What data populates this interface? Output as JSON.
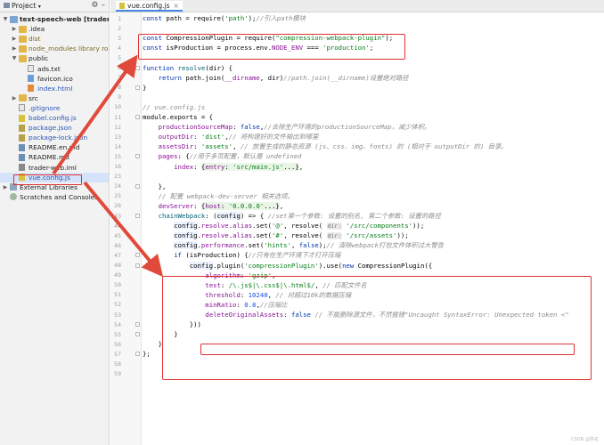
{
  "project_panel": {
    "title": "Project",
    "tree": [
      {
        "label": "text-speech-web [trader-web]",
        "depth": 0,
        "expanded": true,
        "icon": "folder-blue",
        "style": "bold"
      },
      {
        "label": ".idea",
        "depth": 1,
        "expanded": false,
        "icon": "folder"
      },
      {
        "label": "dist",
        "depth": 1,
        "expanded": false,
        "icon": "folder",
        "style": "olive"
      },
      {
        "label": "node_modules  library root",
        "depth": 1,
        "expanded": false,
        "icon": "folder",
        "style": "olive"
      },
      {
        "label": "public",
        "depth": 1,
        "expanded": true,
        "icon": "folder"
      },
      {
        "label": "ads.txt",
        "depth": 2,
        "icon": "file-txt"
      },
      {
        "label": "favicon.ico",
        "depth": 2,
        "icon": "file-ico"
      },
      {
        "label": "index.html",
        "depth": 2,
        "icon": "file-html",
        "style": "blue"
      },
      {
        "label": "src",
        "depth": 1,
        "expanded": false,
        "icon": "folder"
      },
      {
        "label": ".gitignore",
        "depth": 1,
        "icon": "file-txt",
        "style": "blue"
      },
      {
        "label": "babel.config.js",
        "depth": 1,
        "icon": "file-js",
        "style": "blue"
      },
      {
        "label": "package.json",
        "depth": 1,
        "icon": "file-json",
        "style": "blue"
      },
      {
        "label": "package-lock.json",
        "depth": 1,
        "icon": "file-json",
        "style": "blue"
      },
      {
        "label": "README.en.md",
        "depth": 1,
        "icon": "file-md"
      },
      {
        "label": "README.md",
        "depth": 1,
        "icon": "file-md"
      },
      {
        "label": "trader-web.iml",
        "depth": 1,
        "icon": "file-iml"
      },
      {
        "label": "vue.config.js",
        "depth": 1,
        "icon": "file-js",
        "style": "blue",
        "selected": true
      },
      {
        "label": "External Libraries",
        "depth": 0,
        "expanded": false,
        "icon": "lib"
      },
      {
        "label": "Scratches and Consoles",
        "depth": 0,
        "icon": "scratch"
      }
    ]
  },
  "editor": {
    "tab_label": "vue.config.js",
    "lines": [
      {
        "n": 1,
        "html": "<span class=\"kw\">const</span> path = require(<span class=\"str\">'path'</span>);<span class=\"cm\">//引入path模块</span>"
      },
      {
        "n": 2,
        "html": ""
      },
      {
        "n": 3,
        "html": "<span class=\"kw\">const</span> CompressionPlugin = require(<span class=\"str\">\"compression-webpack-plugin\"</span>);"
      },
      {
        "n": 4,
        "html": "<span class=\"kw\">const</span> isProduction = process.env.<span class=\"prop\">NODE_ENV</span> === <span class=\"str\">'production'</span>;"
      },
      {
        "n": 5,
        "html": ""
      },
      {
        "n": 6,
        "html": "<span class=\"kw\">function</span> <span class=\"fn\">resolve</span>(dir) {"
      },
      {
        "n": 7,
        "html": "    <span class=\"kw\">return</span> path.join(<span class=\"prop\">__dirname</span>, dir)<span class=\"cm\">//path.join(__dirname)设置绝对路径</span>"
      },
      {
        "n": 8,
        "html": "}"
      },
      {
        "n": 9,
        "html": ""
      },
      {
        "n": 10,
        "html": "<span class=\"cm\">// vue.config.js</span>"
      },
      {
        "n": 11,
        "html": "module.exports = {"
      },
      {
        "n": 12,
        "html": "    <span class=\"prop\">productionSourceMap</span>: <span class=\"kw\">false</span>,<span class=\"cm\">//去除生产环境的productionSourceMap，减少体积。</span>"
      },
      {
        "n": 13,
        "html": "    <span class=\"prop\">outputDir</span>: <span class=\"str\">'dist'</span>,<span class=\"cm\">// 将构建好的文件输出到哪里</span>"
      },
      {
        "n": 14,
        "html": "    <span class=\"prop\">assetsDir</span>: <span class=\"str\">'assets'</span>, <span class=\"cm\">// 放置生成的静态资源 (js、css、img、fonts) 的 (相对于 outputDir 的) 目录。</span>"
      },
      {
        "n": 15,
        "html": "    <span class=\"prop\">pages</span>: {<span class=\"cm\">//用于多页配置，默认是 undefined</span>"
      },
      {
        "n": 16,
        "html": "        <span class=\"prop\">index</span>: <span class=\"fb\">{<span class=\"prop\">entry</span>: <span class=\"str\">'src/main.js'</span>...}</span>,"
      },
      {
        "n": 23,
        "html": ""
      },
      {
        "n": 24,
        "html": "    },"
      },
      {
        "n": 25,
        "html": "    <span class=\"cm\">// 配置 webpack-dev-server 相关选项。</span>"
      },
      {
        "n": 26,
        "html": "    <span class=\"prop\">devServer</span>: <span class=\"fb\">{<span class=\"prop\">host</span>: <span class=\"str\">'0.0.0.0'</span>...}</span>,"
      },
      {
        "n": 43,
        "html": "    <span class=\"fn\">chainWebpack</span>: (<span class=\"hlv\">config</span>) => { <span class=\"cm\">//set第一个参数: 设置的别名, 第二个参数: 设置的路径</span>"
      },
      {
        "n": 44,
        "html": "        <span class=\"hlv\">config</span>.<span class=\"prop\">resolve</span>.<span class=\"prop\">alias</span>.set(<span class=\"str\">'@'</span>, resolve( <span class=\"hint\">dir:</span> <span class=\"str\">'/src/components'</span>));"
      },
      {
        "n": 45,
        "html": "        <span class=\"hlv\">config</span>.<span class=\"prop\">resolve</span>.<span class=\"prop\">alias</span>.set(<span class=\"str\">'#'</span>, resolve( <span class=\"hint\">dir:</span> <span class=\"str\">'/src/assets'</span>));"
      },
      {
        "n": 46,
        "html": "        <span class=\"hlv\">config</span>.<span class=\"prop\">performance</span>.set(<span class=\"str\">'hints'</span>, <span class=\"kw\">false</span>);<span class=\"cm\">// 清除webpack打包文件体积过大警告</span>"
      },
      {
        "n": 47,
        "html": "        <span class=\"kw\">if</span> (isProduction) {<span class=\"cm\">//只有在生产环境下才打开压缩</span>"
      },
      {
        "n": 48,
        "html": "            <span class=\"hlv\">config</span>.plugin(<span class=\"str\">'compressionPlugin'</span>).use(<span class=\"kw\">new</span> CompressionPlugin({"
      },
      {
        "n": 49,
        "html": "                <span class=\"prop\">algorithm</span>: <span class=\"str\">'gzip'</span>,"
      },
      {
        "n": 50,
        "html": "                <span class=\"prop\">test</span>: <span class=\"str\">/\\.js$|\\.css$|\\.html$/</span>, <span class=\"cm\">// 匹配文件名</span>"
      },
      {
        "n": 51,
        "html": "                <span class=\"prop\">threshold</span>: <span class=\"num\">10240</span>, <span class=\"cm\">// 对超过10k的数据压缩</span>"
      },
      {
        "n": 52,
        "html": "                <span class=\"prop\">minRatio</span>: <span class=\"num\">0.8</span>,<span class=\"cm\">//压缩比</span>"
      },
      {
        "n": 53,
        "html": "                <span class=\"prop\">deleteOriginalAssets</span>: <span class=\"kw\">false</span> <span class=\"cm\">// 不能删除源文件，不然报错\"Uncaught SyntaxError: Unexpected token <\"</span>"
      },
      {
        "n": 54,
        "html": "            }))"
      },
      {
        "n": 55,
        "html": "        }"
      },
      {
        "n": 56,
        "html": "    }"
      },
      {
        "n": 57,
        "html": "};"
      },
      {
        "n": 58,
        "html": ""
      },
      {
        "n": 59,
        "html": ""
      }
    ]
  },
  "watermark": "CSDN @佚名"
}
